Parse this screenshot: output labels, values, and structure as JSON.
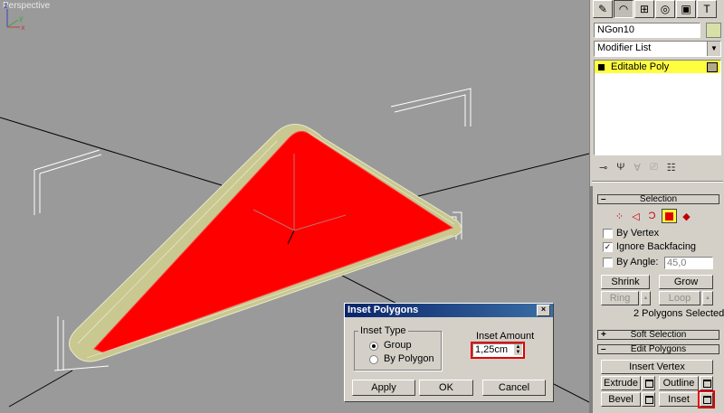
{
  "viewport": {
    "label": "Perspective",
    "polygon_color": "#ff0000",
    "bevel_color": "#c8c890",
    "background_color": "#9a9a9a",
    "tripod_axes": [
      "x",
      "y",
      "z"
    ]
  },
  "command_panel": {
    "object_name": "NGon10",
    "modifier_list_label": "Modifier List",
    "stack_items": [
      {
        "label": "Editable Poly",
        "selected": true
      }
    ],
    "selection_rollout": {
      "title": "Selection",
      "by_vertex_label": "By Vertex",
      "ignore_backfacing_label": "Ignore Backfacing",
      "ignore_backfacing_checked": "✓",
      "by_angle_label": "By Angle:",
      "by_angle_value": "45,0",
      "shrink_label": "Shrink",
      "grow_label": "Grow",
      "ring_label": "Ring",
      "loop_label": "Loop",
      "status": "2 Polygons Selected"
    },
    "soft_selection_title": "Soft Selection",
    "edit_polygons": {
      "title": "Edit Polygons",
      "insert_vertex_label": "Insert Vertex",
      "extrude_label": "Extrude",
      "outline_label": "Outline",
      "bevel_label": "Bevel",
      "inset_label": "Inset"
    },
    "accent_highlight": "#ffff40"
  },
  "dialog": {
    "title": "Inset Polygons",
    "close_glyph": "×",
    "inset_type_label": "Inset Type",
    "option_group": "Group",
    "option_by_polygon": "By Polygon",
    "selected_option": "Group",
    "inset_amount_label": "Inset Amount",
    "inset_amount_value": "1,25cm",
    "apply_label": "Apply",
    "ok_label": "OK",
    "cancel_label": "Cancel"
  }
}
